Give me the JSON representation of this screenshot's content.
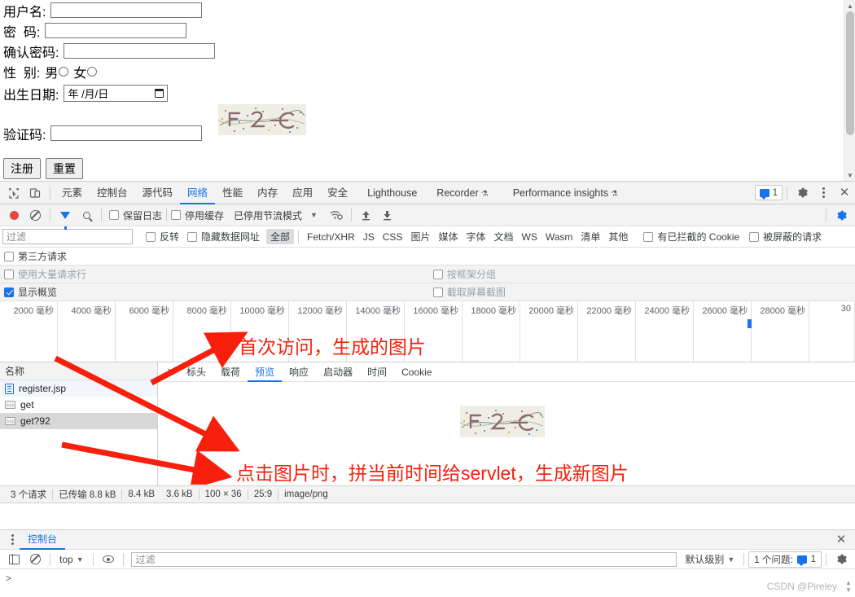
{
  "page": {
    "fields": [
      {
        "label": "用户名:",
        "value": "",
        "width": "w-user"
      },
      {
        "label": "密  码:",
        "value": "",
        "width": "w-pass"
      },
      {
        "label": "确认密码:",
        "value": "",
        "width": "w-conf"
      }
    ],
    "gender": {
      "label": "性  别:",
      "male": "男",
      "female": "女"
    },
    "birth": {
      "label": "出生日期:",
      "placeholder": "年 /月/日"
    },
    "captcha": {
      "label": "验证码:",
      "value": "",
      "alt": "F2C"
    },
    "buttons": {
      "submit": "注册",
      "reset": "重置"
    }
  },
  "devtools": {
    "main_tabs": [
      {
        "label": "元素",
        "selected": false,
        "flask": false
      },
      {
        "label": "控制台",
        "selected": false,
        "flask": false
      },
      {
        "label": "源代码",
        "selected": false,
        "flask": false
      },
      {
        "label": "网络",
        "selected": true,
        "flask": false
      },
      {
        "label": "性能",
        "selected": false,
        "flask": false
      },
      {
        "label": "内存",
        "selected": false,
        "flask": false
      },
      {
        "label": "应用",
        "selected": false,
        "flask": false
      },
      {
        "label": "安全",
        "selected": false,
        "flask": false
      },
      {
        "label": "Lighthouse",
        "selected": false,
        "flask": false
      },
      {
        "label": "Recorder",
        "selected": false,
        "flask": true
      },
      {
        "label": "Performance insights",
        "selected": false,
        "flask": true
      }
    ],
    "issues_count": "1",
    "network_toolbar": {
      "preserve_log": {
        "label": "保留日志",
        "checked": false
      },
      "disable_cache": {
        "label": "停用缓存",
        "checked": false
      },
      "throttling": "已停用节流模式"
    },
    "filter_bar": {
      "placeholder": "过滤",
      "invert": {
        "label": "反转",
        "checked": false
      },
      "hide_data_urls": {
        "label": "隐藏数据网址",
        "checked": false
      },
      "types": [
        "全部",
        "Fetch/XHR",
        "JS",
        "CSS",
        "图片",
        "媒体",
        "字体",
        "文档",
        "WS",
        "Wasm",
        "清单",
        "其他"
      ],
      "selected_type": "全部",
      "blocked_cookies": {
        "label": "有已拦截的 Cookie",
        "checked": false
      },
      "blocked_requests": {
        "label": "被屏蔽的请求",
        "checked": false
      }
    },
    "options": {
      "third_party": {
        "label": "第三方请求",
        "checked": false
      },
      "big_rows": {
        "label": "使用大量请求行",
        "checked": false
      },
      "group_by_frame": {
        "label": "按框架分组",
        "checked": false
      },
      "show_overview": {
        "label": "显示概览",
        "checked": true
      },
      "capture_screenshots": {
        "label": "截取屏幕截图",
        "checked": false
      }
    },
    "timeline": {
      "ticks": [
        "2000 毫秒",
        "4000 毫秒",
        "6000 毫秒",
        "8000 毫秒",
        "10000 毫秒",
        "12000 毫秒",
        "14000 毫秒",
        "16000 毫秒",
        "18000 毫秒",
        "20000 毫秒",
        "22000 毫秒",
        "24000 毫秒",
        "26000 毫秒",
        "28000 毫秒",
        "30"
      ]
    },
    "requests": {
      "column_header": "名称",
      "rows": [
        {
          "name": "register.jsp",
          "icon": "document-icon",
          "selected": false
        },
        {
          "name": "get",
          "icon": "image-icon",
          "selected": false
        },
        {
          "name": "get?92",
          "icon": "image-icon",
          "selected": true
        }
      ]
    },
    "detail_tabs": [
      {
        "label": "标头",
        "selected": false
      },
      {
        "label": "载荷",
        "selected": false
      },
      {
        "label": "预览",
        "selected": true
      },
      {
        "label": "响应",
        "selected": false
      },
      {
        "label": "启动器",
        "selected": false
      },
      {
        "label": "时间",
        "selected": false
      },
      {
        "label": "Cookie",
        "selected": false
      }
    ],
    "status_bar": [
      "3 个请求",
      "已传输 8.8 kB",
      "8.4 kB",
      "3.6 kB",
      "100 × 36",
      "25:9",
      "image/png"
    ],
    "drawer": {
      "tab": "控制台",
      "context": "top",
      "filter_placeholder": "过滤",
      "level": "默认级别",
      "issues_label": "1 个问题:",
      "issues_count": "1",
      "prompt": ">"
    }
  },
  "annotations": [
    {
      "text": "首次访问，生成的图片"
    },
    {
      "text": "点击图片时，拼当前时间给servlet，生成新图片"
    }
  ],
  "watermark": "CSDN @Pireley",
  "colors": {
    "accent": "#1a73e8",
    "annotation": "#f81f0d",
    "record": "#e8453c"
  }
}
